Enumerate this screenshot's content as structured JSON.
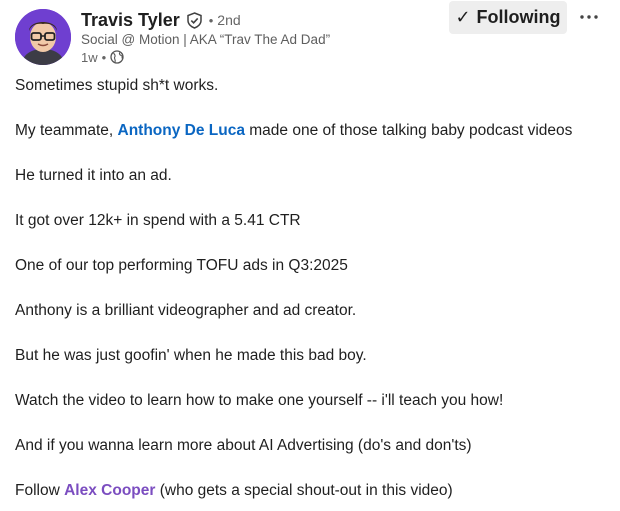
{
  "post": {
    "author": {
      "name": "Travis Tyler",
      "degree": "2nd",
      "separator": "•",
      "headline": "Social @ Motion | AKA “Trav The Ad Dad”",
      "time": "1w",
      "visibility_icon": "globe-icon",
      "verified_icon": "verified-shield-icon"
    },
    "follow_button": {
      "check_icon": "✓",
      "label": "Following"
    },
    "more_menu": {
      "icon": "more-icon",
      "label": "···"
    },
    "body": {
      "p1": "Sometimes stupid sh*t works.",
      "p2_pre": "My teammate, ",
      "p2_mention": "Anthony De Luca",
      "p2_post": " made one of those talking baby podcast videos",
      "p3": "He turned it into an ad.",
      "p4": "It got over 12k+ in spend with a 5.41 CTR",
      "p5": "One of our top performing TOFU ads in Q3:2025",
      "p6": "Anthony is a brilliant videographer and ad creator.",
      "p7": "But he was just goofin' when he made this bad boy.",
      "p8": "Watch the video to learn how to make one yourself -- i'll teach you how!",
      "p9": "And if you wanna learn more about AI Advertising (do's and don'ts)",
      "p10_pre": "Follow ",
      "p10_mention": "Alex Cooper",
      "p10_post": " (who gets a special shout-out in this video)"
    },
    "colors": {
      "link_blue": "#0a66c2",
      "link_purple": "#7b4dc0",
      "button_bg": "#eeeeee",
      "avatar_bg": "#6f3fd0"
    }
  }
}
